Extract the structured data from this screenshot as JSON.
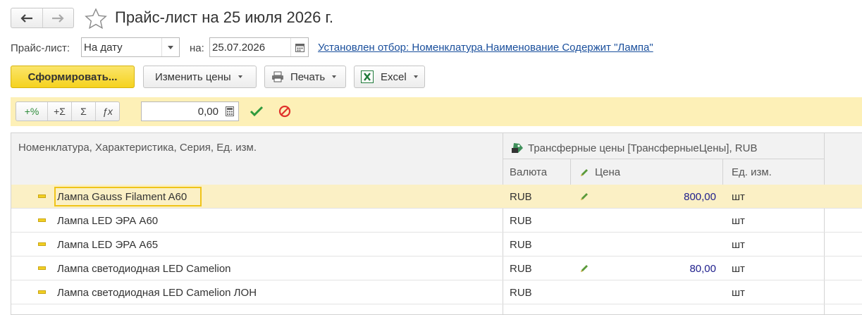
{
  "header": {
    "title": "Прайс-лист на 25 июля 2026 г."
  },
  "filter_bar": {
    "pricelist_label": "Прайс-лист:",
    "mode_value": "На дату",
    "date_label": "на:",
    "date_value": "25.07.2026",
    "filter_link": "Установлен отбор: Номенклатура.Наименование Содержит \"Лампа\""
  },
  "toolbar": {
    "generate_label": "Сформировать...",
    "change_prices_label": "Изменить цены",
    "print_label": "Печать",
    "excel_label": "Excel"
  },
  "edit_bar": {
    "percent_label": "+%",
    "add_sum_label": "+Σ",
    "sum_label": "Σ",
    "formula_label": "ƒx",
    "number_value": "0,00"
  },
  "table": {
    "columns": {
      "item": "Номенклатура, Характеристика, Серия, Ед. изм.",
      "group": "Трансферные цены [ТрансферныеЦены], RUB",
      "currency": "Валюта",
      "price": "Цена",
      "unit": "Ед. изм."
    },
    "rows": [
      {
        "name": "Лампа Gauss Filament A60",
        "currency": "RUB",
        "price": "800,00",
        "unit": "шт"
      },
      {
        "name": "Лампа LED ЭРА A60",
        "currency": "RUB",
        "price": "",
        "unit": "шт"
      },
      {
        "name": "Лампа LED ЭРА A65",
        "currency": "RUB",
        "price": "",
        "unit": "шт"
      },
      {
        "name": "Лампа светодиодная LED Camelion",
        "currency": "RUB",
        "price": "80,00",
        "unit": "шт"
      },
      {
        "name": "Лампа светодиодная LED Camelion ЛОН",
        "currency": "RUB",
        "price": "",
        "unit": "шт"
      }
    ]
  },
  "colors": {
    "accent_yellow": "#f5d21f",
    "toolbar_yellow": "#fdf0b7",
    "link_blue": "#1a4f9c",
    "price_blue": "#1e1e8c"
  }
}
